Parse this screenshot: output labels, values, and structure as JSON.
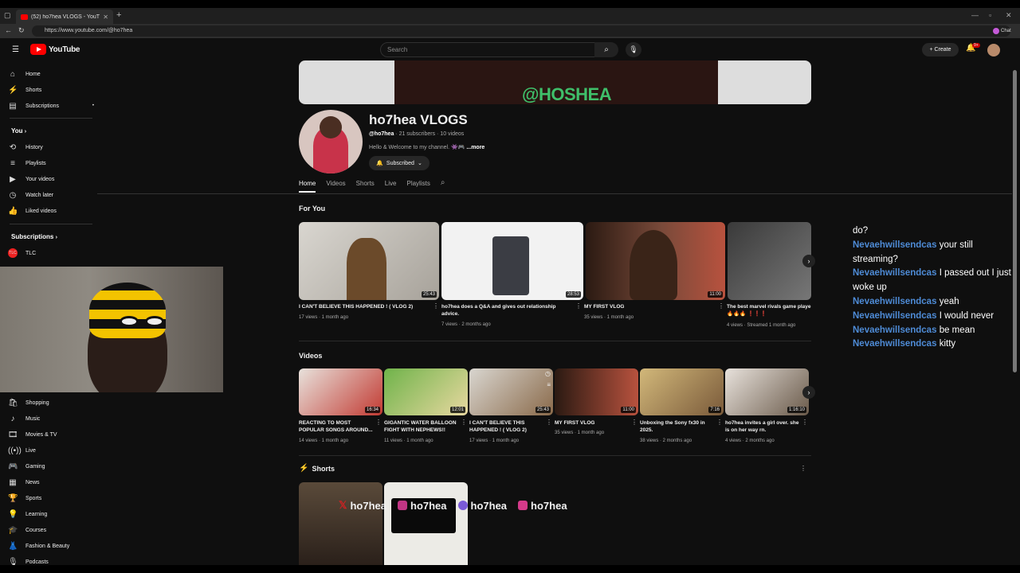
{
  "browser": {
    "tab_title": "(52) ho7hea VLOGS - YouTube",
    "url": "https://www.youtube.com/@ho7hea",
    "chat_label": "Chat"
  },
  "header": {
    "logo": "YouTube",
    "search_placeholder": "Search",
    "create_label": "Create",
    "notif_badge": "9+"
  },
  "sidebar": {
    "top": [
      {
        "label": "Home",
        "icon": "home-icon"
      },
      {
        "label": "Shorts",
        "icon": "shorts-icon"
      },
      {
        "label": "Subscriptions",
        "icon": "subscriptions-icon"
      }
    ],
    "you_heading": "You",
    "you_items": [
      {
        "label": "History",
        "icon": "history-icon"
      },
      {
        "label": "Playlists",
        "icon": "playlists-icon"
      },
      {
        "label": "Your videos",
        "icon": "your-videos-icon"
      },
      {
        "label": "Watch later",
        "icon": "watch-later-icon"
      },
      {
        "label": "Liked videos",
        "icon": "liked-icon"
      }
    ],
    "subs_heading": "Subscriptions",
    "subs_items": [
      {
        "label": "TLC"
      }
    ],
    "explore_items": [
      {
        "label": "Shopping",
        "icon": "shopping-icon"
      },
      {
        "label": "Music",
        "icon": "music-icon"
      },
      {
        "label": "Movies & TV",
        "icon": "movies-icon"
      },
      {
        "label": "Live",
        "icon": "live-icon"
      },
      {
        "label": "Gaming",
        "icon": "gaming-icon"
      },
      {
        "label": "News",
        "icon": "news-icon"
      },
      {
        "label": "Sports",
        "icon": "sports-icon"
      },
      {
        "label": "Learning",
        "icon": "learning-icon"
      },
      {
        "label": "Courses",
        "icon": "courses-icon"
      },
      {
        "label": "Fashion & Beauty",
        "icon": "fashion-icon"
      },
      {
        "label": "Podcasts",
        "icon": "podcasts-icon"
      }
    ]
  },
  "channel": {
    "banner_handle": "@HOSHEA",
    "name": "ho7hea VLOGS",
    "handle": "@ho7hea",
    "meta": " · 21 subscribers · 10 videos",
    "description": "Hello & Welcome to my channel. 👾🎮",
    "more": "...more",
    "subscribed_label": "Subscribed",
    "tabs": [
      "Home",
      "Videos",
      "Shorts",
      "Live",
      "Playlists"
    ]
  },
  "for_you": {
    "heading": "For You",
    "videos": [
      {
        "title": "I CAN'T BELIEVE THIS HAPPENED ! ( VLOG 2)",
        "meta": "17 views · 1 month ago",
        "duration": "25:43"
      },
      {
        "title": "ho7hea does a Q&A and gives out relationship advice.",
        "meta": "7 views · 2 months ago",
        "duration": "28:53"
      },
      {
        "title": "MY FIRST VLOG",
        "meta": "35 views · 1 month ago",
        "duration": "11:00"
      },
      {
        "title": "The best marvel rivals game playe",
        "title2": "🔥🔥🔥 ❗❗❗",
        "meta": "4 views · Streamed 1 month ago",
        "duration": ""
      }
    ]
  },
  "videos": {
    "heading": "Videos",
    "items": [
      {
        "title": "REACTING TO MOST POPULAR SONGS AROUND...",
        "meta": "14 views · 1 month ago",
        "duration": "16:34"
      },
      {
        "title": "GIGANTIC WATER BALLOON FIGHT WITH NEPHEWS!!",
        "meta": "11 views · 1 month ago",
        "duration": "12:01"
      },
      {
        "title": "I CAN'T BELIEVE THIS HAPPENED ! ( VLOG 2)",
        "meta": "17 views · 1 month ago",
        "duration": "25:43"
      },
      {
        "title": "MY FIRST VLOG",
        "meta": "35 views · 1 month ago",
        "duration": "11:00"
      },
      {
        "title": "Unboxing the Sony fx30 in 2025.",
        "meta": "38 views · 2 months ago",
        "duration": "7:16"
      },
      {
        "title": "ho7hea invites a girl over. she is on her way rn.",
        "meta": "4 views · 2 months ago",
        "duration": "1:16:10"
      }
    ]
  },
  "shorts": {
    "heading": "Shorts"
  },
  "overlay": {
    "socials": [
      "ho7hea",
      "ho7hea",
      "ho7hea",
      "ho7hea"
    ],
    "chat": [
      {
        "user": "",
        "msg": "do?"
      },
      {
        "user": "Nevaehwillsendcas",
        "msg": "your still"
      },
      {
        "user": "",
        "msg": "streaming?"
      },
      {
        "user": "Nevaehwillsendcas",
        "msg": "I passed out I just"
      },
      {
        "user": "",
        "msg": "woke up"
      },
      {
        "user": "Nevaehwillsendcas",
        "msg": "yeah"
      },
      {
        "user": "Nevaehwillsendcas",
        "msg": "I would never"
      },
      {
        "user": "Nevaehwillsendcas",
        "msg": "be mean"
      },
      {
        "user": "Nevaehwillsendcas",
        "msg": "kitty"
      }
    ]
  }
}
